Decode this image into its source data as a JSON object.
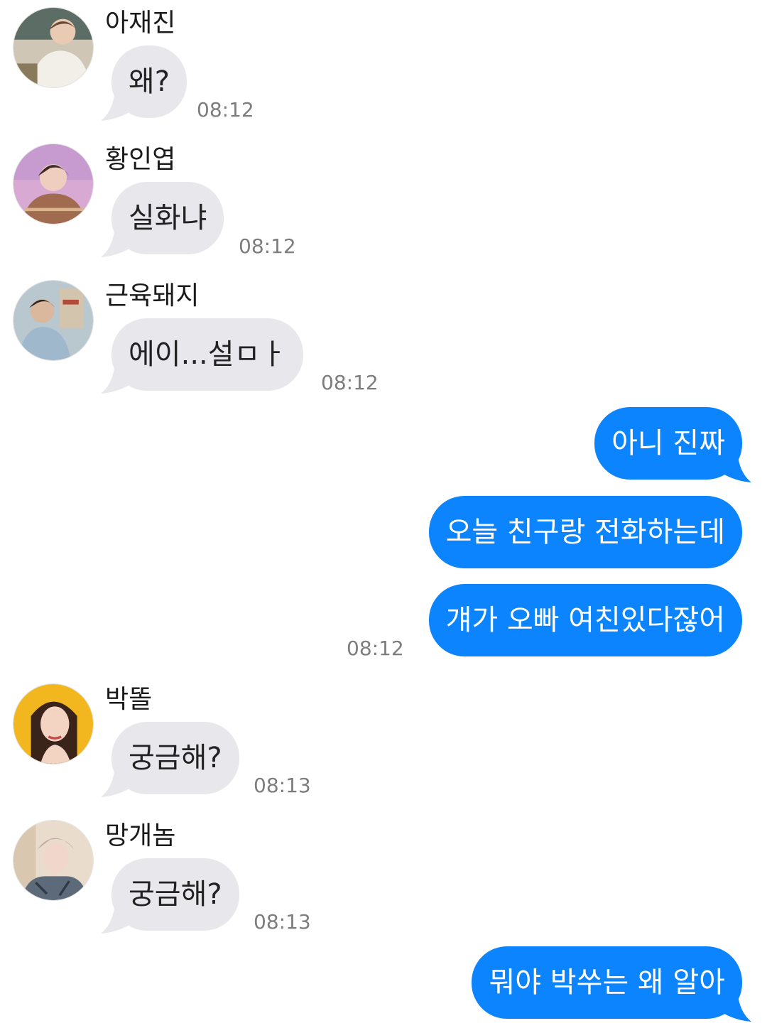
{
  "messages": [
    {
      "sender": "아재진",
      "text": "왜?",
      "time": "08:12"
    },
    {
      "sender": "황인엽",
      "text": "실화냐",
      "time": "08:12"
    },
    {
      "sender": "근육돼지",
      "text": "에이...설ㅁㅏ",
      "time": "08:12"
    },
    {
      "text": "아니 진짜"
    },
    {
      "text": "오늘 친구랑 전화하는데"
    },
    {
      "text": "걔가 오빠 여친있다잖어",
      "time": "08:12"
    },
    {
      "sender": "박똘",
      "text": "궁금해?",
      "time": "08:13"
    },
    {
      "sender": "망개놈",
      "text": "궁금해?",
      "time": "08:13"
    },
    {
      "text": "뭐야 박쑤는 왜 알아"
    }
  ],
  "colors": {
    "incoming_bubble": "#e8e8ec",
    "outgoing_bubble": "#0b84fe",
    "timestamp": "#7d7d7d"
  }
}
